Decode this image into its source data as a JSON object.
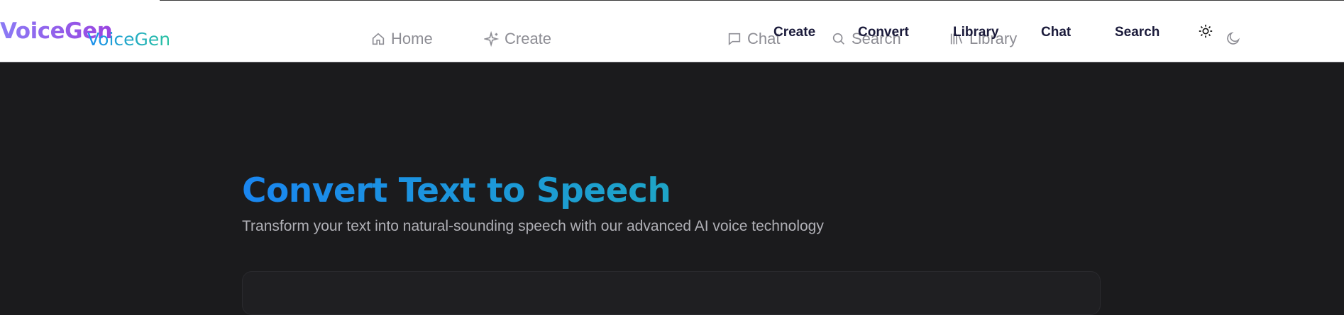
{
  "brand": {
    "logo_primary": "VoiceGen",
    "logo_secondary": "VoiceGen"
  },
  "ghost_nav": {
    "home": "Home",
    "create": "Create",
    "chat": "Chat",
    "search": "Search",
    "library": "Library"
  },
  "nav": {
    "create": "Create",
    "convert": "Convert",
    "library": "Library",
    "chat": "Chat",
    "search": "Search"
  },
  "theme": {
    "light_icon": "sun-icon",
    "dark_icon": "moon-icon"
  },
  "hero": {
    "title": "Convert Text to Speech",
    "subtitle": "Transform your text into natural-sounding speech with our advanced AI voice technology"
  },
  "colors": {
    "title_start": "#1a86f0",
    "title_end": "#1fb0b8",
    "background": "#1b1b1d",
    "nav_text": "#1a1a3a"
  }
}
